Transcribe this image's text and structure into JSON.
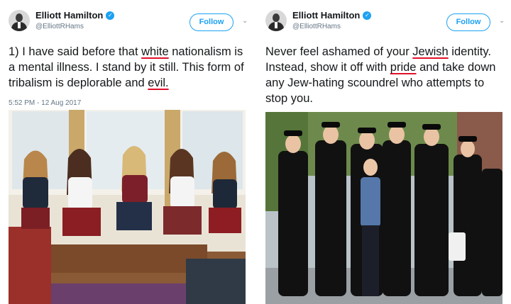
{
  "tweets": [
    {
      "author": {
        "name": "Elliott Hamilton",
        "handle": "@ElliottRHams",
        "verified": true
      },
      "follow_label": "Follow",
      "text": {
        "p1": "1) I have said before that ",
        "u1": "white",
        "p2": " nationalism is a mental illness. I stand by it still. This form of tribalism is deplorable and ",
        "u2": "evil.",
        "p3": ""
      },
      "timestamp": "5:52 PM - 12 Aug 2017",
      "photo_description_icon": "photo-girls-icon"
    },
    {
      "author": {
        "name": "Elliott Hamilton",
        "handle": "@ElliottRHams",
        "verified": true
      },
      "follow_label": "Follow",
      "text": {
        "p1": "Never feel ashamed of your ",
        "u1": "Jewish",
        "p2": " identity. Instead, show it off with ",
        "u2": "pride",
        "p3": " and take down any Jew-hating scoundrel who attempts to stop you."
      },
      "timestamp": "",
      "photo_description_icon": "photo-men-icon"
    }
  ],
  "colors": {
    "accent": "#1da1f2",
    "underline": "#e0112b",
    "muted": "#657786"
  }
}
